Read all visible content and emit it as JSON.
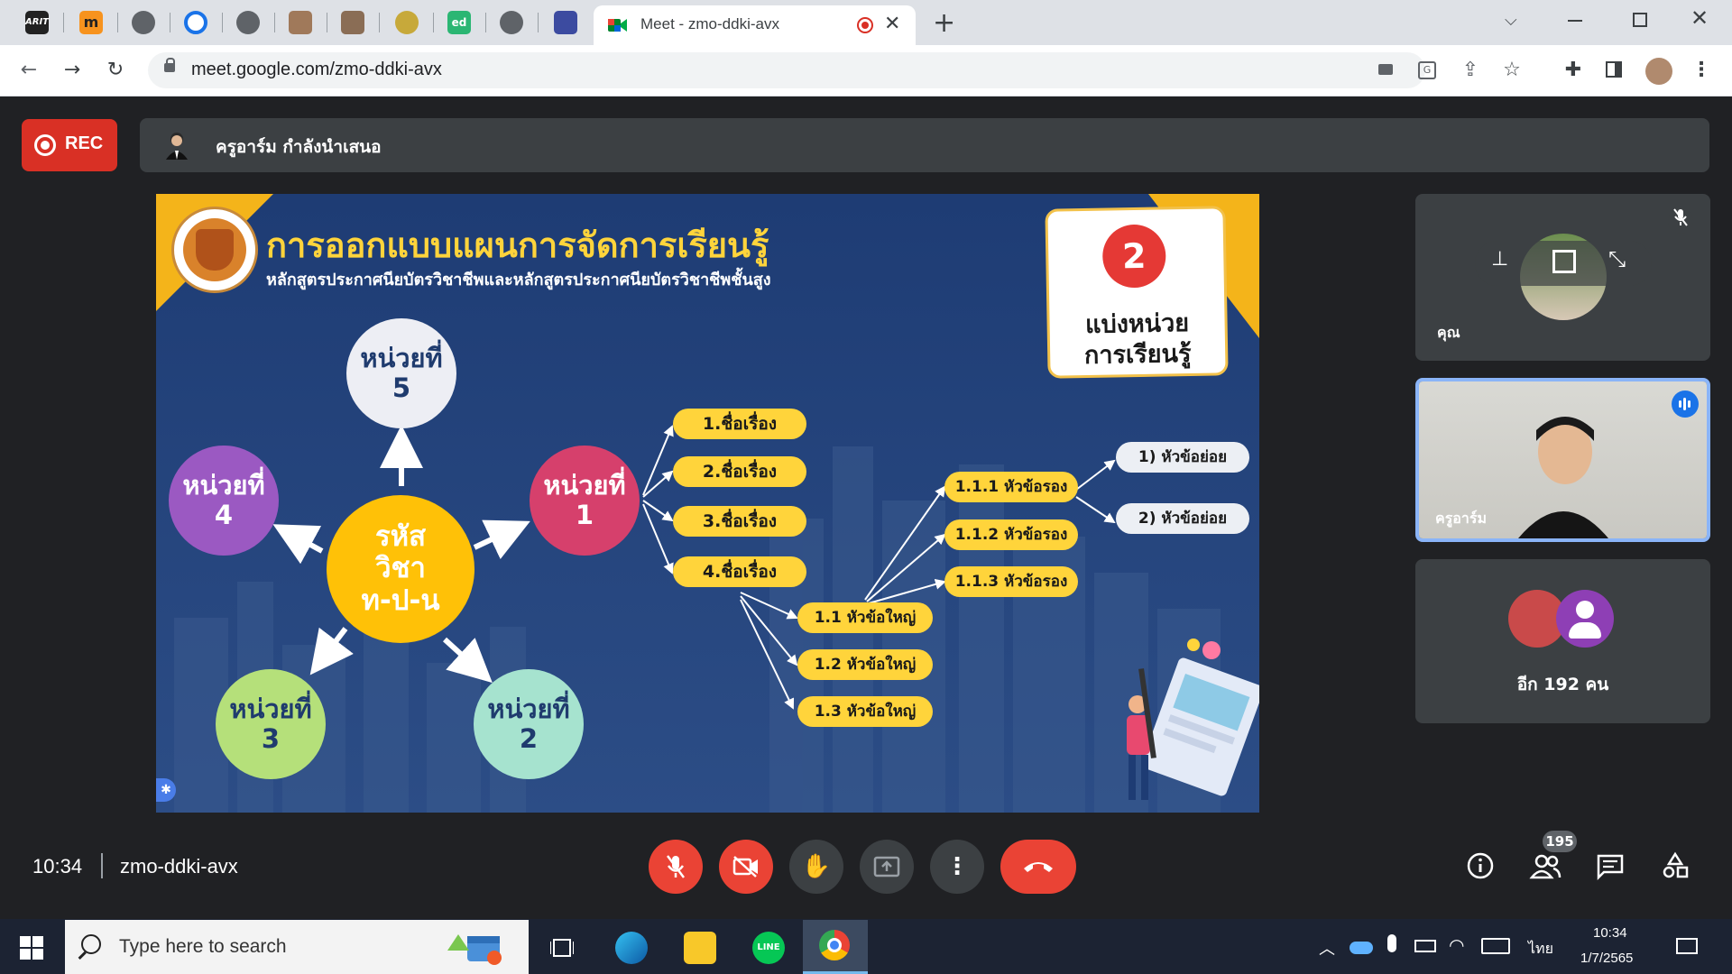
{
  "browser": {
    "tabs_pinned": [
      "ARIT",
      "m",
      "",
      "O",
      "",
      "",
      "",
      "",
      "ed",
      "",
      ""
    ],
    "active_tab_title": "Meet - zmo-ddki-avx",
    "url": "meet.google.com/zmo-ddki-avx",
    "icons": {
      "back": "arrow-left-icon",
      "forward": "arrow-right-icon",
      "reload": "reload-icon",
      "lock": "lock-icon",
      "camera": "camera-icon",
      "translate": "translate-icon",
      "share": "share-icon",
      "bookmark": "star-icon",
      "extensions": "puzzle-icon",
      "sidepanel": "side-panel-icon",
      "menu": "more-vert-icon"
    }
  },
  "meet": {
    "rec_label": "REC",
    "presenter_label": "ครูอาร์ม กำลังนำเสนอ",
    "meeting_time": "10:34",
    "meeting_code": "zmo-ddki-avx",
    "participants_count": "195",
    "tiles": [
      {
        "name": "คุณ",
        "muted": true
      },
      {
        "name": "ครูอาร์ม",
        "speaking": true
      },
      {
        "others_label": "อีก 192 คน"
      }
    ],
    "colors": {
      "accent_red": "#ea4335",
      "rec_red": "#d93025",
      "speaking_blue": "#8ab4f8",
      "bg": "#202124"
    }
  },
  "slide": {
    "title": "การออกแบบแผนการจัดการเรียนรู้",
    "subtitle": "หลักสูตรประกาศนียบัตรวิชาชีพและหลักสูตรประกาศนียบัตรวิชาชีพชั้นสูง",
    "step_number": "2",
    "step_label_line1": "แบ่งหน่วย",
    "step_label_line2": "การเรียนรู้",
    "center": {
      "line1": "รหัส",
      "line2": "วิชา",
      "line3": "ท-ป-น"
    },
    "units": [
      {
        "line1": "หน่วยที่",
        "line2": "1"
      },
      {
        "line1": "หน่วยที่",
        "line2": "2"
      },
      {
        "line1": "หน่วยที่",
        "line2": "3"
      },
      {
        "line1": "หน่วยที่",
        "line2": "4"
      },
      {
        "line1": "หน่วยที่",
        "line2": "5"
      }
    ],
    "topics": [
      "1.ชื่อเรื่อง",
      "2.ชื่อเรื่อง",
      "3.ชื่อเรื่อง",
      "4.ชื่อเรื่อง"
    ],
    "main_headings": [
      "1.1 หัวข้อใหญ่",
      "1.2 หัวข้อใหญ่",
      "1.3 หัวข้อใหญ่"
    ],
    "sub_headings": [
      "1.1.1 หัวข้อรอง",
      "1.1.2 หัวข้อรอง",
      "1.1.3 หัวข้อรอง"
    ],
    "minor_headings": [
      "1) หัวข้อย่อย",
      "2) หัวข้อย่อย"
    ]
  },
  "taskbar": {
    "search_placeholder": "Type here to search",
    "language": "ไทย",
    "clock_time": "10:34",
    "clock_date": "1/7/2565"
  }
}
